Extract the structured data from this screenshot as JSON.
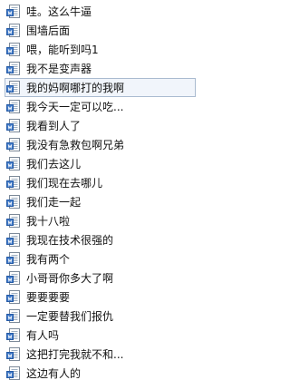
{
  "files": {
    "icon": "text-document-icon",
    "selected_index": 4,
    "items": [
      {
        "label": "哇。这么牛逼"
      },
      {
        "label": "围墙后面"
      },
      {
        "label": "喂，能听到吗1"
      },
      {
        "label": "我不是变声器"
      },
      {
        "label": "我的妈啊哪打的我啊"
      },
      {
        "label": "我今天一定可以吃..."
      },
      {
        "label": "我看到人了"
      },
      {
        "label": "我没有急救包啊兄弟"
      },
      {
        "label": "我们去这儿"
      },
      {
        "label": "我们现在去哪儿"
      },
      {
        "label": "我们走一起"
      },
      {
        "label": "我十八啦"
      },
      {
        "label": "我现在技术很强的"
      },
      {
        "label": "我有两个"
      },
      {
        "label": "小哥哥你多大了啊"
      },
      {
        "label": "要要要要"
      },
      {
        "label": "一定要替我们报仇"
      },
      {
        "label": "有人吗"
      },
      {
        "label": "这把打完我就不和..."
      },
      {
        "label": "这边有人的"
      }
    ]
  }
}
